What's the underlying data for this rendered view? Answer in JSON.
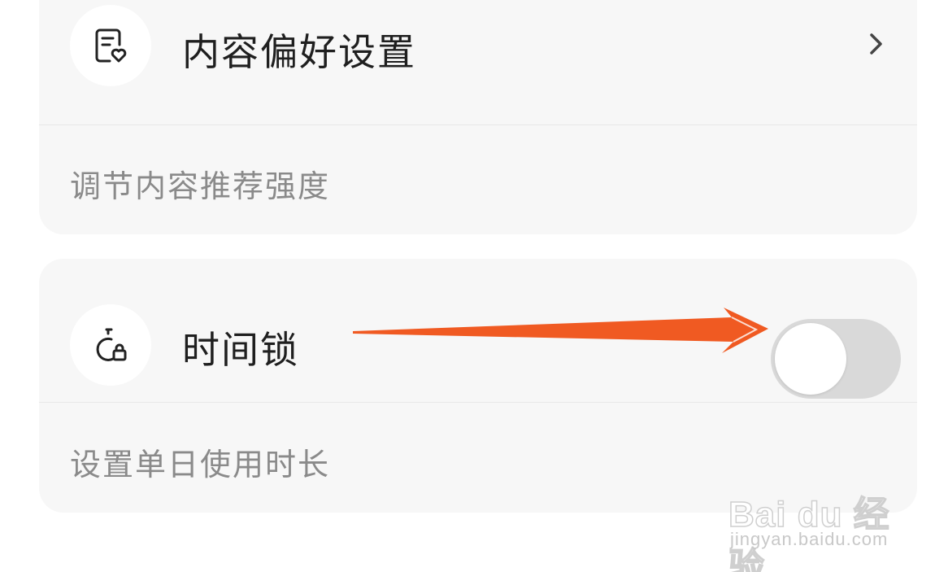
{
  "content_pref": {
    "title": "内容偏好设置",
    "subtitle": "调节内容推荐强度",
    "icon": "document-heart-icon"
  },
  "time_lock": {
    "title": "时间锁",
    "subtitle": "设置单日使用时长",
    "icon": "timer-lock-icon",
    "toggle_on": false
  },
  "annotation": {
    "arrow_color": "#f05a22"
  },
  "watermark": {
    "brand": "Bai du 经验",
    "url": "jingyan.baidu.com"
  },
  "colors": {
    "card_bg": "#f7f7f7",
    "toggle_off": "#d9d9d9",
    "title_text": "#1f1f1f",
    "subtitle_text": "#8a8a8a"
  }
}
